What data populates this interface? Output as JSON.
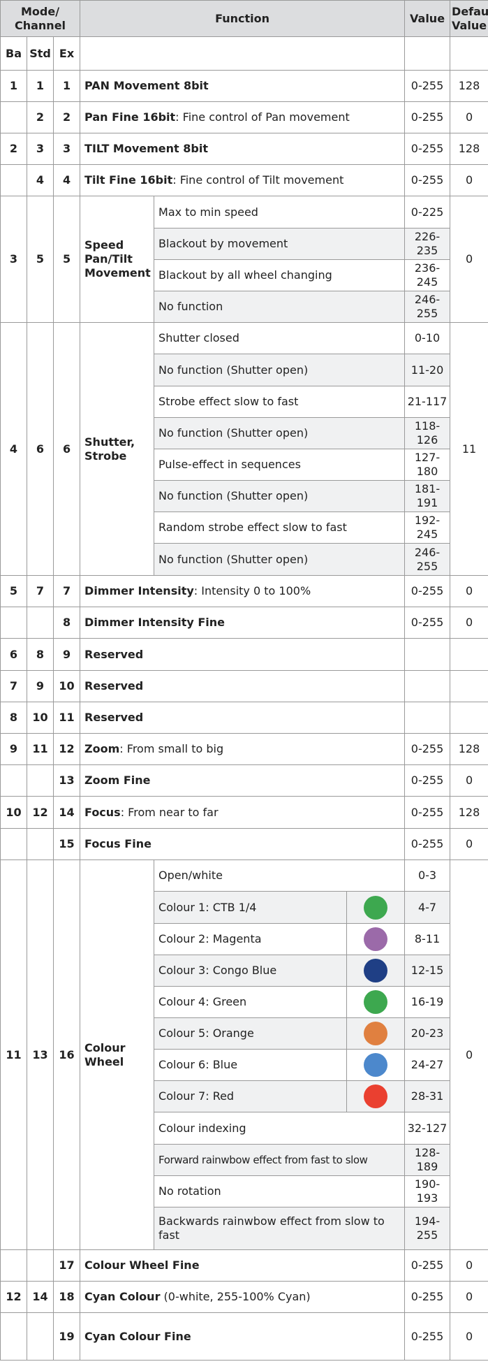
{
  "header": {
    "mode_channel": "Mode/ Channel",
    "function": "Function",
    "value": "Value",
    "default_value": "Default Value",
    "ba": "Ba",
    "std": "Std",
    "ex": "Ex"
  },
  "rows": {
    "pan": {
      "ba": "1",
      "std": "1",
      "ex": "1",
      "label": "PAN Movement 8bit",
      "value": "0-255",
      "default": "128"
    },
    "pan_fine": {
      "ba": "",
      "std": "2",
      "ex": "2",
      "label": "Pan Fine 16bit",
      "desc": ": Fine control of Pan movement",
      "value": "0-255",
      "default": "0"
    },
    "tilt": {
      "ba": "2",
      "std": "3",
      "ex": "3",
      "label": "TILT Movement 8bit",
      "value": "0-255",
      "default": "128"
    },
    "tilt_fine": {
      "ba": "",
      "std": "4",
      "ex": "4",
      "label": "Tilt Fine 16bit",
      "desc": ": Fine control of Tilt movement",
      "value": "0-255",
      "default": "0"
    },
    "speed": {
      "ba": "3",
      "std": "5",
      "ex": "5",
      "label": "Speed Pan/Tilt Movement",
      "default": "0",
      "subs": [
        {
          "text": "Max to min speed",
          "value": "0-225"
        },
        {
          "text": "Blackout by movement",
          "value": "226-235"
        },
        {
          "text": "Blackout by all wheel changing",
          "value": "236-245"
        },
        {
          "text": "No function",
          "value": "246-255"
        }
      ]
    },
    "shutter": {
      "ba": "4",
      "std": "6",
      "ex": "6",
      "label": "Shutter, Strobe",
      "default": "11",
      "subs": [
        {
          "text": "Shutter closed",
          "value": "0-10"
        },
        {
          "text": "No function (Shutter open)",
          "value": "11-20"
        },
        {
          "text": "Strobe effect slow to fast",
          "value": "21-117"
        },
        {
          "text": "No function (Shutter open)",
          "value": "118-126"
        },
        {
          "text": "Pulse-effect in sequences",
          "value": "127-180"
        },
        {
          "text": "No function (Shutter open)",
          "value": "181-191"
        },
        {
          "text": "Random strobe effect slow to fast",
          "value": "192-245"
        },
        {
          "text": "No function (Shutter open)",
          "value": "246-255"
        }
      ]
    },
    "dimmer": {
      "ba": "5",
      "std": "7",
      "ex": "7",
      "label": "Dimmer Intensity",
      "desc": ": Intensity 0 to 100%",
      "value": "0-255",
      "default": "0"
    },
    "dimmer_fine": {
      "ba": "",
      "std": "",
      "ex": "8",
      "label": "Dimmer Intensity Fine",
      "value": "0-255",
      "default": "0"
    },
    "reserved1": {
      "ba": "6",
      "std": "8",
      "ex": "9",
      "label": "Reserved",
      "value": "",
      "default": ""
    },
    "reserved2": {
      "ba": "7",
      "std": "9",
      "ex": "10",
      "label": "Reserved",
      "value": "",
      "default": ""
    },
    "reserved3": {
      "ba": "8",
      "std": "10",
      "ex": "11",
      "label": "Reserved",
      "value": "",
      "default": ""
    },
    "zoom": {
      "ba": "9",
      "std": "11",
      "ex": "12",
      "label": "Zoom",
      "desc": ": From small to big",
      "value": "0-255",
      "default": "128"
    },
    "zoom_fine": {
      "ba": "",
      "std": "",
      "ex": "13",
      "label": "Zoom Fine",
      "value": "0-255",
      "default": "0"
    },
    "focus": {
      "ba": "10",
      "std": "12",
      "ex": "14",
      "label": "Focus",
      "desc": ": From near to far",
      "value": "0-255",
      "default": "128"
    },
    "focus_fine": {
      "ba": "",
      "std": "",
      "ex": "15",
      "label": "Focus Fine",
      "value": "0-255",
      "default": "0"
    },
    "colour": {
      "ba": "11",
      "std": "13",
      "ex": "16",
      "label": "Colour Wheel",
      "default": "0",
      "open": {
        "text": "Open/white",
        "value": "0-3"
      },
      "colours": [
        {
          "text": "Colour 1: CTB 1/4",
          "value": "4-7",
          "color": "#3da84f"
        },
        {
          "text": "Colour 2: Magenta",
          "value": "8-11",
          "color": "#9b6aa9"
        },
        {
          "text": "Colour 3: Congo Blue",
          "value": "12-15",
          "color": "#1f3f85"
        },
        {
          "text": "Colour 4: Green",
          "value": "16-19",
          "color": "#3da84f"
        },
        {
          "text": "Colour 5: Orange",
          "value": "20-23",
          "color": "#e08040"
        },
        {
          "text": "Colour 6: Blue",
          "value": "24-27",
          "color": "#4c88cc"
        },
        {
          "text": "Colour 7: Red",
          "value": "28-31",
          "color": "#ea4030"
        }
      ],
      "tail": [
        {
          "text": "Colour indexing",
          "value": "32-127"
        },
        {
          "text": "Forward rainwbow effect from fast to slow",
          "value": "128-189"
        },
        {
          "text": "No rotation",
          "value": "190-193"
        },
        {
          "text": "Backwards rainwbow effect from slow to fast",
          "value": "194-255"
        }
      ]
    },
    "colour_fine": {
      "ba": "",
      "std": "",
      "ex": "17",
      "label": "Colour Wheel Fine",
      "value": "0-255",
      "default": "0"
    },
    "cyan": {
      "ba": "12",
      "std": "14",
      "ex": "18",
      "label": "Cyan Colour",
      "desc": " (0-white, 255-100% Cyan)",
      "value": "0-255",
      "default": "0"
    },
    "cyan_fine": {
      "ba": "",
      "std": "",
      "ex": "19",
      "label": "Cyan Colour Fine",
      "value": "0-255",
      "default": "0"
    }
  }
}
